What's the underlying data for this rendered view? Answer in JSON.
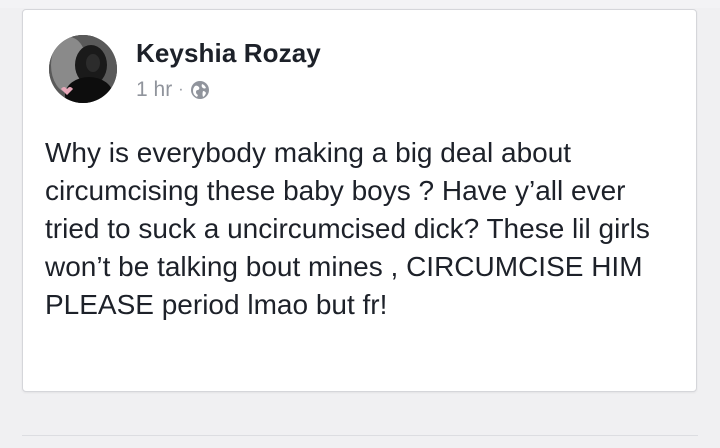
{
  "post": {
    "author_name": "Keyshia Rozay",
    "timestamp": "1 hr",
    "separator": "·",
    "privacy_icon": "globe-icon",
    "text": "Why is everybody making a big deal about circumcising these baby boys ? Have y’all ever tried to suck a uncircumcised dick? These lil girls won’t be talking bout mines , CIRCUMCISE HIM PLEASE period lmao but fr!"
  },
  "colors": {
    "name": "#1d2129",
    "meta": "#90949c",
    "card_border": "#d5d6da",
    "background": "#f0f0f2"
  }
}
